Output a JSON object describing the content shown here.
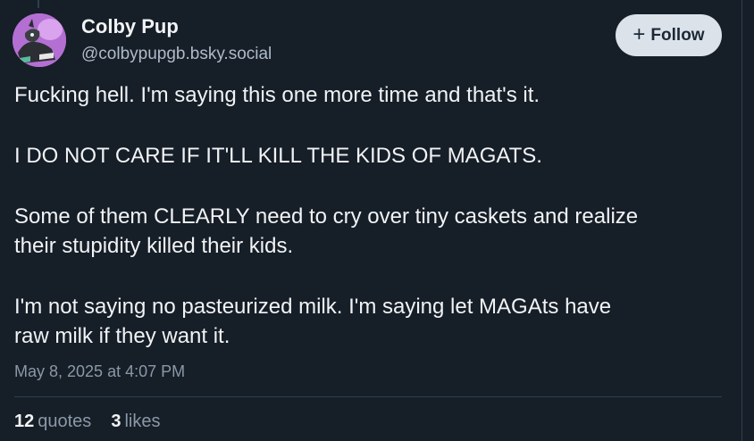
{
  "author": {
    "display_name": "Colby Pup",
    "handle": "@colbypupgb.bsky.social",
    "avatar_icon": "avatar-dragon-icon"
  },
  "follow_button": {
    "icon": "+",
    "label": "Follow"
  },
  "post": {
    "lines": [
      "Fucking hell. I'm saying this one more time and that's it.",
      "I DO NOT CARE IF IT'LL KILL THE KIDS OF MAGATS.",
      "Some of them CLEARLY need to cry over tiny caskets and realize",
      "their stupidity killed their kids.",
      "I'm not saying no pasteurized milk. I'm saying let MAGAts have",
      "raw milk if they want it."
    ],
    "timestamp": "May 8, 2025 at 4:07 PM"
  },
  "stats": {
    "quotes_count": "12",
    "quotes_label": "quotes",
    "likes_count": "3",
    "likes_label": "likes"
  },
  "colors": {
    "background": "#161e27",
    "text": "#f1f3f5",
    "muted": "#8a98a8",
    "button_bg": "#dce2ea"
  }
}
